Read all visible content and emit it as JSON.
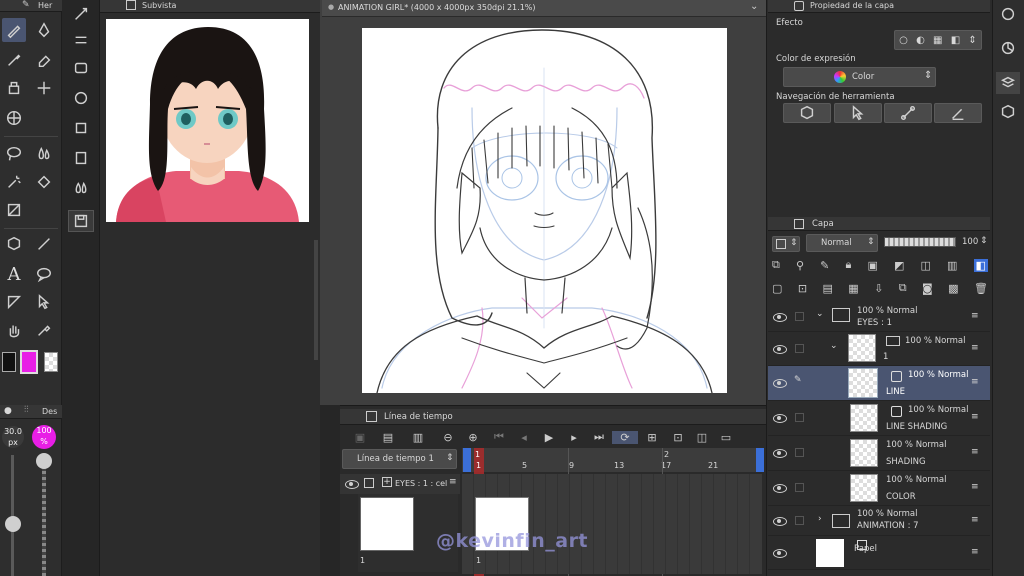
{
  "tool_panel": {
    "tab_label": "Her",
    "brush_size": "30.0",
    "brush_unit": "px",
    "opacity": "100",
    "opacity_unit": "%",
    "sub_tab": "Des"
  },
  "subview": {
    "title": "Subvista"
  },
  "canvas": {
    "tab_title": "ANIMATION GIRL* (4000 x 4000px 350dpi 21.1%)"
  },
  "properties": {
    "title": "Propiedad de la capa",
    "effect_label": "Efecto",
    "expression_color_label": "Color de expresión",
    "color_value": "Color",
    "tool_nav_label": "Navegación de herramienta"
  },
  "layers": {
    "title": "Capa",
    "blend_mode": "Normal",
    "opacity": "100",
    "rows": [
      {
        "pct": "100 % Normal",
        "name": "EYES : 1"
      },
      {
        "pct": "100 % Normal",
        "name": "1"
      },
      {
        "pct": "100 % Normal",
        "name": "LINE"
      },
      {
        "pct": "100 % Normal",
        "name": "LINE SHADING"
      },
      {
        "pct": "100 % Normal",
        "name": "SHADING"
      },
      {
        "pct": "100 % Normal",
        "name": "COLOR"
      },
      {
        "pct": "100 % Normal",
        "name": "ANIMATION : 7"
      },
      {
        "pct": "",
        "name": "Papel"
      }
    ]
  },
  "timeline": {
    "title": "Línea de tiempo",
    "selector": "Línea de tiempo 1",
    "track_label": "EYES : 1 : cel",
    "frame_label": "1",
    "ruler_top": [
      "1",
      "2"
    ],
    "ruler_bottom": [
      "1",
      "5",
      "9",
      "13",
      "17",
      "21"
    ]
  },
  "watermark": "@kevinfin_art",
  "colors": {
    "magenta": "#e81ee6",
    "panel": "#2b2b2b",
    "header": "#363636",
    "selected_layer": "#4a5571",
    "playhead": "#d92828"
  }
}
